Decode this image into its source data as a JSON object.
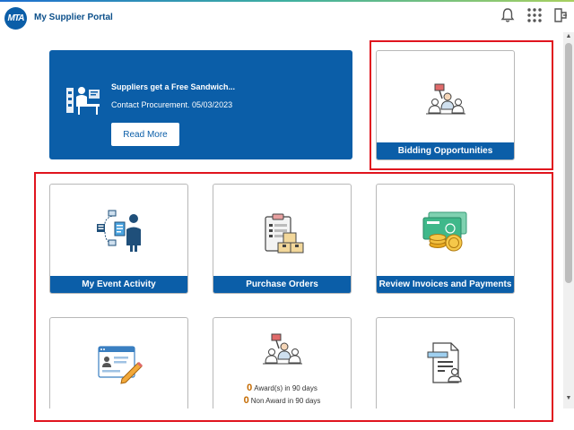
{
  "header": {
    "logo_text": "MTA",
    "title": "My Supplier Portal"
  },
  "banner": {
    "title": "Suppliers get a Free Sandwich...",
    "text": "Contact Procurement. 05/03/2023",
    "button_label": "Read More"
  },
  "tiles": {
    "bidding": {
      "label": "Bidding Opportunities"
    },
    "event_activity": {
      "label": "My Event Activity"
    },
    "purchase_orders": {
      "label": "Purchase Orders"
    },
    "invoices": {
      "label": "Review Invoices and Payments"
    },
    "awards": {
      "award_count": "0",
      "award_text": "Award(s) in 90 days",
      "non_award_count": "0",
      "non_award_text": "Non Award in 90 days"
    }
  },
  "colors": {
    "brand": "#0b5ea8",
    "highlight": "#e0141e",
    "count": "#c46a00"
  }
}
